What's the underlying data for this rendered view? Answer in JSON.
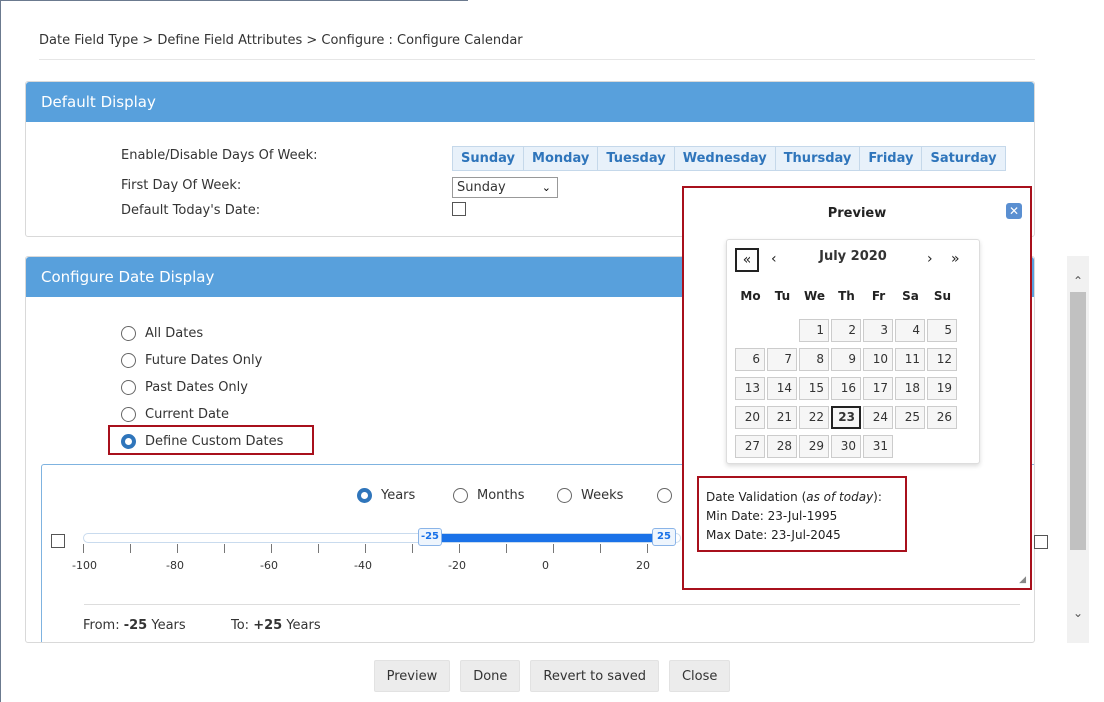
{
  "breadcrumb": "Date Field Type > Define Field Attributes > Configure : Configure Calendar",
  "default_display": {
    "title": "Default Display",
    "enable_days_label": "Enable/Disable Days Of Week:",
    "first_day_label": "First Day Of Week:",
    "default_today_label": "Default Today's Date:",
    "days": [
      "Sunday",
      "Monday",
      "Tuesday",
      "Wednesday",
      "Thursday",
      "Friday",
      "Saturday"
    ],
    "first_day_value": "Sunday"
  },
  "configure_date_display": {
    "title": "Configure Date Display",
    "options": [
      {
        "label": "All Dates",
        "selected": false
      },
      {
        "label": "Future Dates Only",
        "selected": false
      },
      {
        "label": "Past Dates Only",
        "selected": false
      },
      {
        "label": "Current Date",
        "selected": false
      },
      {
        "label": "Define Custom Dates",
        "selected": true
      }
    ],
    "units": [
      {
        "label": "Years",
        "selected": true
      },
      {
        "label": "Months",
        "selected": false
      },
      {
        "label": "Weeks",
        "selected": false
      }
    ],
    "slider": {
      "min": -100,
      "visible_max": 20,
      "from_value": "-25",
      "to_value": "25",
      "ticks": [
        "-100",
        "-80",
        "-60",
        "-40",
        "-20",
        "0",
        "20"
      ]
    },
    "from_label": "From:",
    "from_value": "-25",
    "to_label": "To:",
    "to_value": "+25",
    "unit_word": "Years"
  },
  "buttons": [
    "Preview",
    "Done",
    "Revert to saved",
    "Close"
  ],
  "preview": {
    "title": "Preview",
    "month_label": "July 2020",
    "nav": {
      "prev_year": "«",
      "prev_month": "‹",
      "next_month": "›",
      "next_year": "»"
    },
    "weekdays": [
      "Mo",
      "Tu",
      "We",
      "Th",
      "Fr",
      "Sa",
      "Su"
    ],
    "weeks": [
      [
        "",
        "",
        "1",
        "2",
        "3",
        "4",
        "5"
      ],
      [
        "6",
        "7",
        "8",
        "9",
        "10",
        "11",
        "12"
      ],
      [
        "13",
        "14",
        "15",
        "16",
        "17",
        "18",
        "19"
      ],
      [
        "20",
        "21",
        "22",
        "23",
        "24",
        "25",
        "26"
      ],
      [
        "27",
        "28",
        "29",
        "30",
        "31",
        "",
        ""
      ]
    ],
    "today": "23",
    "validation": {
      "heading_prefix": "Date Validation (",
      "heading_italic": "as of today",
      "heading_suffix": "):",
      "min_date": "Min Date: 23-Jul-1995",
      "max_date": "Max Date: 23-Jul-2045"
    }
  },
  "icons": {
    "close": "close-icon",
    "dropdown": "chevron-down-icon",
    "scroll_up": "chevron-up-icon",
    "scroll_down": "chevron-down-icon"
  },
  "colors": {
    "header": "#58a0dc",
    "accent": "#2f75bb",
    "highlight_border": "#a8101c",
    "slider_range": "#1a72e8"
  }
}
